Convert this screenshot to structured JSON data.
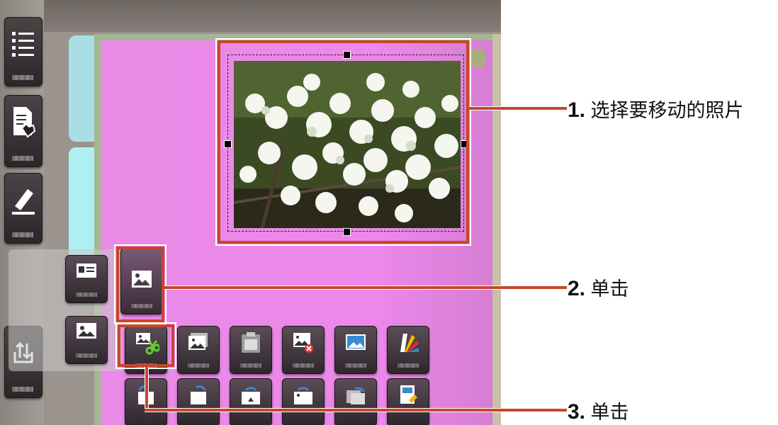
{
  "annotations": [
    {
      "num": "1.",
      "text": "选择要移动的照片"
    },
    {
      "num": "2.",
      "text": "单击"
    },
    {
      "num": "3.",
      "text": "单击"
    }
  ],
  "icons": {
    "sidebar": [
      "list-icon",
      "document-hand-icon",
      "highlighter-icon",
      "export-icon"
    ],
    "panel": [
      "contact-card-icon",
      "picture-icon",
      "picture-icon"
    ],
    "toolbar_row1": [
      "cut-picture-icon",
      "picture-icon",
      "paste-picture-icon",
      "delete-picture-icon",
      "picture-icon",
      "color-palette-icon"
    ],
    "toolbar_row2": [
      "rotate-left-icon",
      "rotate-right-icon",
      "flip-up-icon",
      "flip-down-icon",
      "rotate-icon",
      "picture-settings-icon"
    ]
  },
  "colors": {
    "callout": "#c8462b",
    "page": "#e98ae6",
    "tile": "#3a3036"
  }
}
